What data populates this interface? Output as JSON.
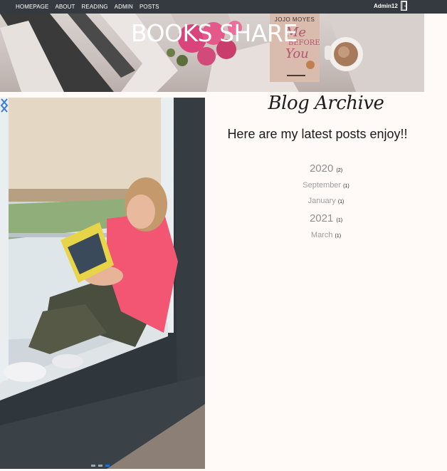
{
  "nav": {
    "links": [
      "HOMEPAGE",
      "ABOUT",
      "READING",
      "ADMIN",
      "POSTS"
    ],
    "user": "Admin12",
    "logout_icon": "door-icon"
  },
  "banner": {
    "title": "BOOKS SHARE",
    "book_author": "JOJO MOYES",
    "book_title_1": "Me",
    "book_title_2": "BEFORE",
    "book_title_3": "You"
  },
  "archive": {
    "heading": "Blog Archive",
    "subtitle": "Here are my latest posts enjoy!!",
    "years": [
      {
        "year": "2020",
        "count": "(2)",
        "months": [
          {
            "name": "September",
            "count": "(1)"
          },
          {
            "name": "January",
            "count": "(1)"
          }
        ]
      },
      {
        "year": "2021",
        "count": "(1)",
        "months": [
          {
            "name": "March",
            "count": "(1)"
          }
        ]
      }
    ]
  },
  "carousel": {
    "prev_icon": "chevron-left-icon",
    "next_icon": "chevron-right-icon",
    "slides": 3,
    "active_slide": 2,
    "colors": {
      "shirt": "#f25673",
      "wall": "#2b3338",
      "blind": "#e3d6c3",
      "window": "#c6cfd6"
    }
  }
}
